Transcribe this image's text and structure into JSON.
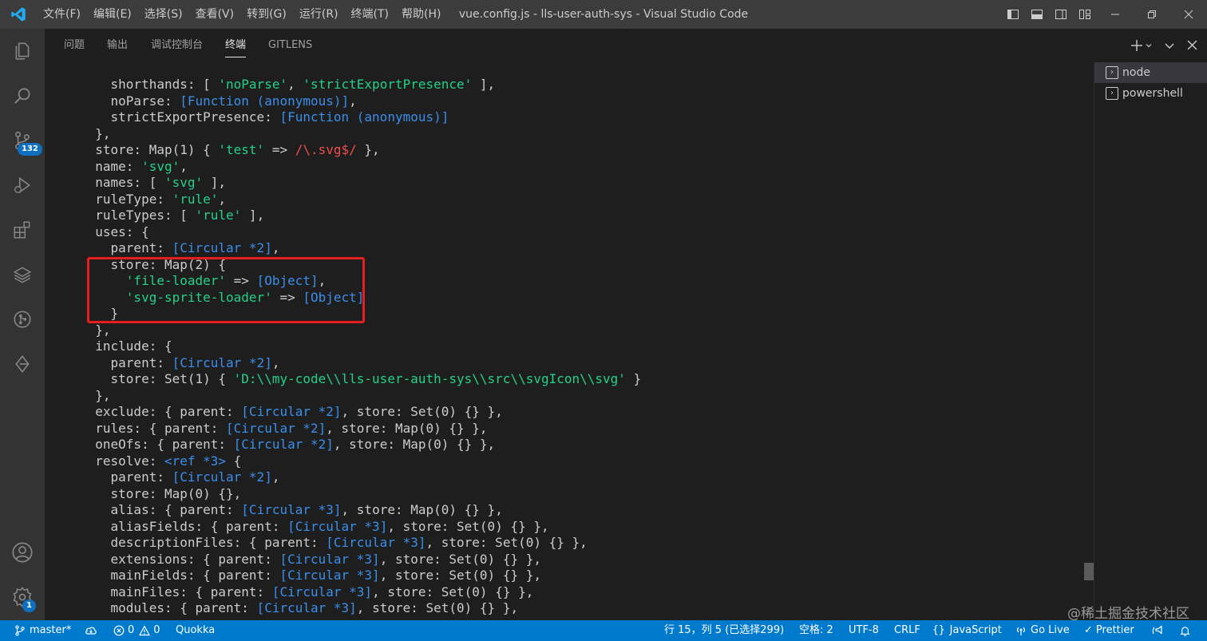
{
  "menu": [
    "文件(F)",
    "编辑(E)",
    "选择(S)",
    "查看(V)",
    "转到(G)",
    "运行(R)",
    "终端(T)",
    "帮助(H)"
  ],
  "window_title": "vue.config.js - lls-user-auth-sys - Visual Studio Code",
  "activity": {
    "scm_badge": "132",
    "settings_badge": "1"
  },
  "panel_tabs": [
    "问题",
    "输出",
    "调试控制台",
    "终端",
    "GITLENS"
  ],
  "active_tab": "终端",
  "terminals": [
    "node",
    "powershell"
  ],
  "code_lines": [
    [
      [
        "    shorthands: [ ",
        ""
      ],
      [
        "'noParse'",
        "s"
      ],
      [
        ", ",
        ""
      ],
      [
        "'strictExportPresence'",
        "s"
      ],
      [
        " ],",
        ""
      ]
    ],
    [
      [
        "    noParse: ",
        ""
      ],
      [
        "[Function (anonymous)]",
        "c"
      ],
      [
        ",",
        ""
      ]
    ],
    [
      [
        "    strictExportPresence: ",
        ""
      ],
      [
        "[Function (anonymous)]",
        "c"
      ]
    ],
    [
      [
        "  },",
        ""
      ]
    ],
    [
      [
        "  store: Map(1) { ",
        ""
      ],
      [
        "'test'",
        "s"
      ],
      [
        " => ",
        ""
      ],
      [
        "/\\.svg$/",
        "r"
      ],
      [
        " },",
        ""
      ]
    ],
    [
      [
        "  name: ",
        ""
      ],
      [
        "'svg'",
        "s"
      ],
      [
        ",",
        ""
      ]
    ],
    [
      [
        "  names: [ ",
        ""
      ],
      [
        "'svg'",
        "s"
      ],
      [
        " ],",
        ""
      ]
    ],
    [
      [
        "  ruleType: ",
        ""
      ],
      [
        "'rule'",
        "s"
      ],
      [
        ",",
        ""
      ]
    ],
    [
      [
        "  ruleTypes: [ ",
        ""
      ],
      [
        "'rule'",
        "s"
      ],
      [
        " ],",
        ""
      ]
    ],
    [
      [
        "  uses: {",
        ""
      ]
    ],
    [
      [
        "    parent: ",
        ""
      ],
      [
        "[Circular *2]",
        "c"
      ],
      [
        ",",
        ""
      ]
    ],
    [
      [
        "    store: Map(2) {",
        ""
      ]
    ],
    [
      [
        "      ",
        ""
      ],
      [
        "'file-loader'",
        "s"
      ],
      [
        " => ",
        ""
      ],
      [
        "[Object]",
        "c"
      ],
      [
        ",",
        ""
      ]
    ],
    [
      [
        "      ",
        ""
      ],
      [
        "'svg-sprite-loader'",
        "s"
      ],
      [
        " => ",
        ""
      ],
      [
        "[Object]",
        "c"
      ]
    ],
    [
      [
        "    }",
        ""
      ]
    ],
    [
      [
        "  },",
        ""
      ]
    ],
    [
      [
        "  include: {",
        ""
      ]
    ],
    [
      [
        "    parent: ",
        ""
      ],
      [
        "[Circular *2]",
        "c"
      ],
      [
        ",",
        ""
      ]
    ],
    [
      [
        "    store: Set(1) { ",
        ""
      ],
      [
        "'D:\\\\my-code\\\\lls-user-auth-sys\\\\src\\\\svgIcon\\\\svg'",
        "s"
      ],
      [
        " }",
        ""
      ]
    ],
    [
      [
        "  },",
        ""
      ]
    ],
    [
      [
        "  exclude: { parent: ",
        ""
      ],
      [
        "[Circular *2]",
        "c"
      ],
      [
        ", store: Set(0) {} },",
        ""
      ]
    ],
    [
      [
        "  rules: { parent: ",
        ""
      ],
      [
        "[Circular *2]",
        "c"
      ],
      [
        ", store: Map(0) {} },",
        ""
      ]
    ],
    [
      [
        "  oneOfs: { parent: ",
        ""
      ],
      [
        "[Circular *2]",
        "c"
      ],
      [
        ", store: Map(0) {} },",
        ""
      ]
    ],
    [
      [
        "  resolve: ",
        ""
      ],
      [
        "<ref *3>",
        "c"
      ],
      [
        " {",
        ""
      ]
    ],
    [
      [
        "    parent: ",
        ""
      ],
      [
        "[Circular *2]",
        "c"
      ],
      [
        ",",
        ""
      ]
    ],
    [
      [
        "    store: Map(0) {},",
        ""
      ]
    ],
    [
      [
        "    alias: { parent: ",
        ""
      ],
      [
        "[Circular *3]",
        "c"
      ],
      [
        ", store: Map(0) {} },",
        ""
      ]
    ],
    [
      [
        "    aliasFields: { parent: ",
        ""
      ],
      [
        "[Circular *3]",
        "c"
      ],
      [
        ", store: Set(0) {} },",
        ""
      ]
    ],
    [
      [
        "    descriptionFiles: { parent: ",
        ""
      ],
      [
        "[Circular *3]",
        "c"
      ],
      [
        ", store: Set(0) {} },",
        ""
      ]
    ],
    [
      [
        "    extensions: { parent: ",
        ""
      ],
      [
        "[Circular *3]",
        "c"
      ],
      [
        ", store: Set(0) {} },",
        ""
      ]
    ],
    [
      [
        "    mainFields: { parent: ",
        ""
      ],
      [
        "[Circular *3]",
        "c"
      ],
      [
        ", store: Set(0) {} },",
        ""
      ]
    ],
    [
      [
        "    mainFiles: { parent: ",
        ""
      ],
      [
        "[Circular *3]",
        "c"
      ],
      [
        ", store: Set(0) {} },",
        ""
      ]
    ],
    [
      [
        "    modules: { parent: ",
        ""
      ],
      [
        "[Circular *3]",
        "c"
      ],
      [
        ", store: Set(0) {} },",
        ""
      ]
    ]
  ],
  "status": {
    "branch": "master*",
    "errors": "0",
    "warnings": "0",
    "quokka": "Quokka",
    "position": "行 15，列 5 (已选择299)",
    "spaces": "空格: 2",
    "encoding": "UTF-8",
    "eol": "CRLF",
    "language": "JavaScript",
    "golive": "Go Live",
    "prettier": "Prettier"
  },
  "watermark": "@稀土掘金技术社区"
}
